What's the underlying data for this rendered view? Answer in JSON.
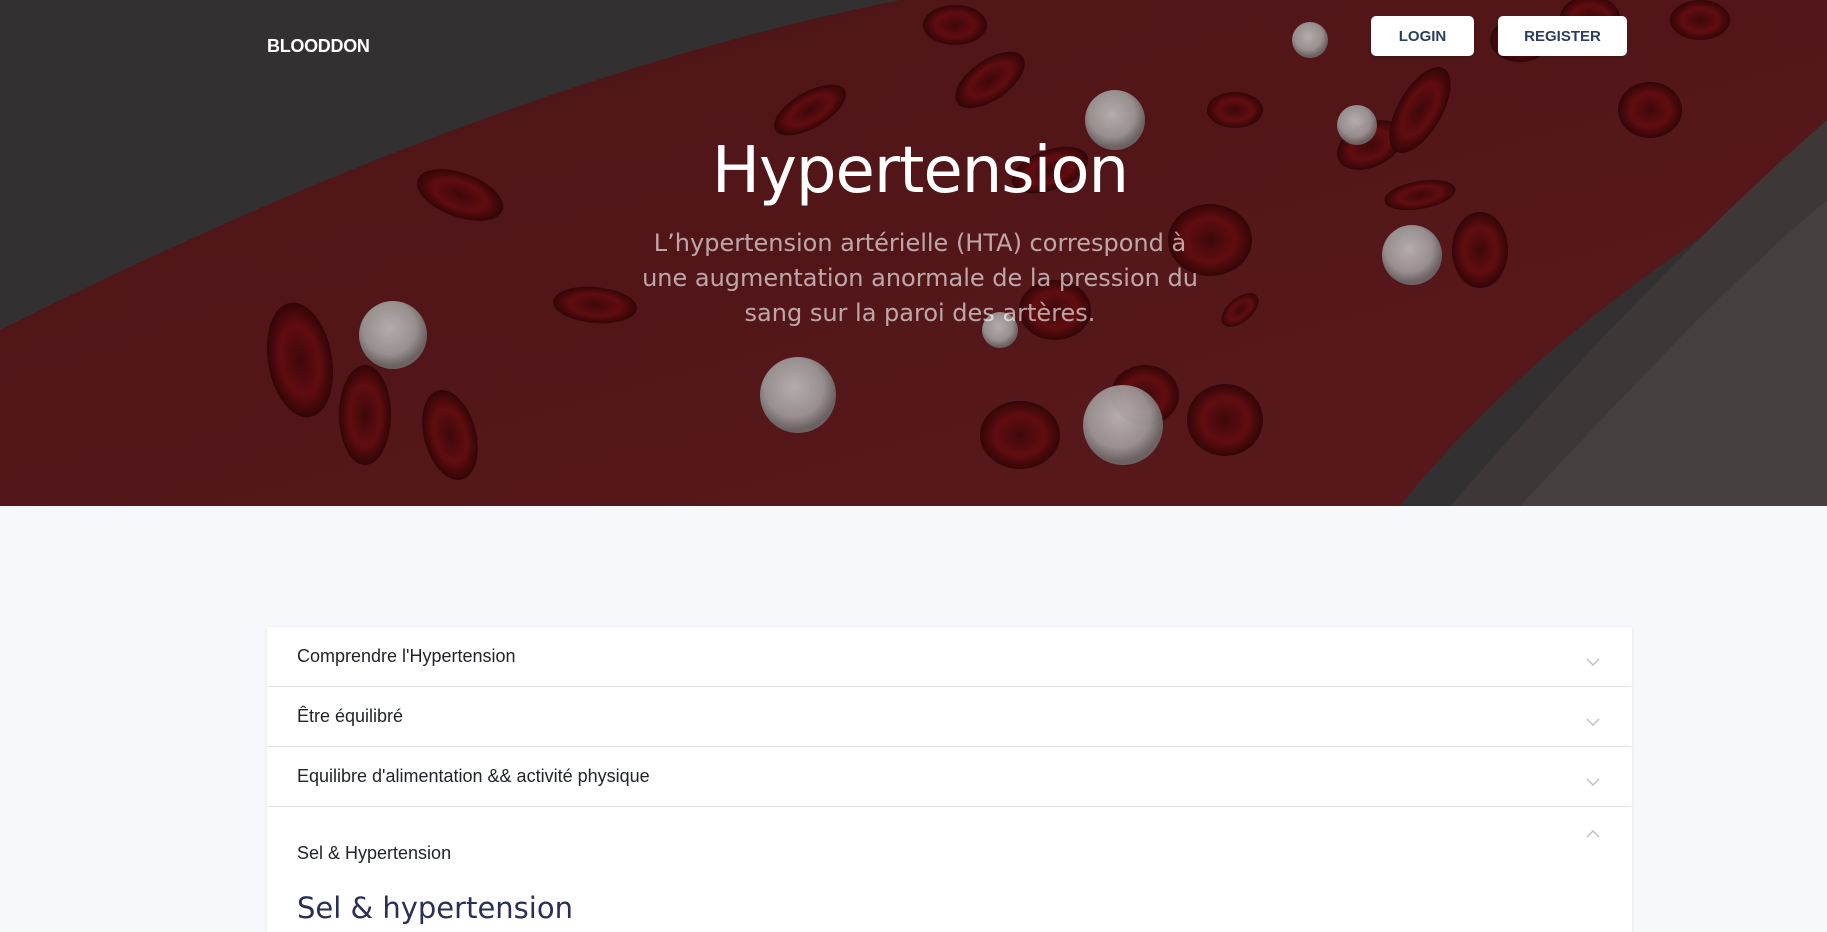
{
  "header": {
    "brand": "BLOODDON",
    "login_label": "LOGIN",
    "register_label": "REGISTER"
  },
  "hero": {
    "title": "Hypertension",
    "subtitle": "L’hypertension artérielle (HTA) correspond à une augmentation anormale de la pression du sang sur la paroi des artères."
  },
  "accordion": {
    "items": [
      {
        "label": "Comprendre l'Hypertension",
        "state": "collapsed",
        "icon": "chevron-down-icon"
      },
      {
        "label": "Être équilibré",
        "state": "collapsed",
        "icon": "chevron-down-icon"
      },
      {
        "label": "Equilibre d'alimentation && activité physique",
        "state": "collapsed",
        "icon": "chevron-down-icon"
      },
      {
        "label": "Sel & Hypertension",
        "state": "expanded",
        "icon": "chevron-up-icon",
        "content_title": "Sel & hypertension"
      }
    ]
  },
  "colors": {
    "page_background": "#f7f8fc",
    "button_text": "#2c3e60",
    "content_title": "#2a2f55"
  }
}
